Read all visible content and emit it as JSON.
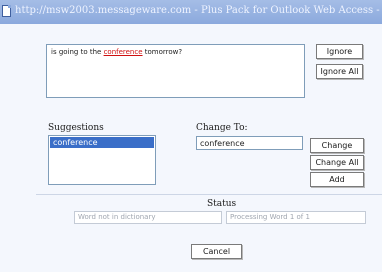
{
  "window": {
    "title": "http://msw2003.messageware.com - Plus Pack for Outlook Web Access - Micros..."
  },
  "sentence": {
    "before": "is going to the ",
    "misspelled": "conference",
    "after": " tomorrow?"
  },
  "buttons": {
    "ignore": "Ignore",
    "ignore_all": "Ignore All",
    "change": "Change",
    "change_all": "Change All",
    "add": "Add",
    "cancel": "Cancel"
  },
  "suggestions": {
    "label": "Suggestions",
    "items": [
      "conference"
    ],
    "selected_index": 0
  },
  "change_to": {
    "label": "Change To:",
    "value": "conference"
  },
  "status": {
    "label": "Status",
    "left": "Word not in dictionary",
    "right": "Processing Word 1 of 1"
  },
  "colors": {
    "titlebar": "#8ba9dd",
    "selection": "#3a6ec8",
    "misspelled": "#d01010",
    "dialog_bg": "#f4f7fd"
  }
}
